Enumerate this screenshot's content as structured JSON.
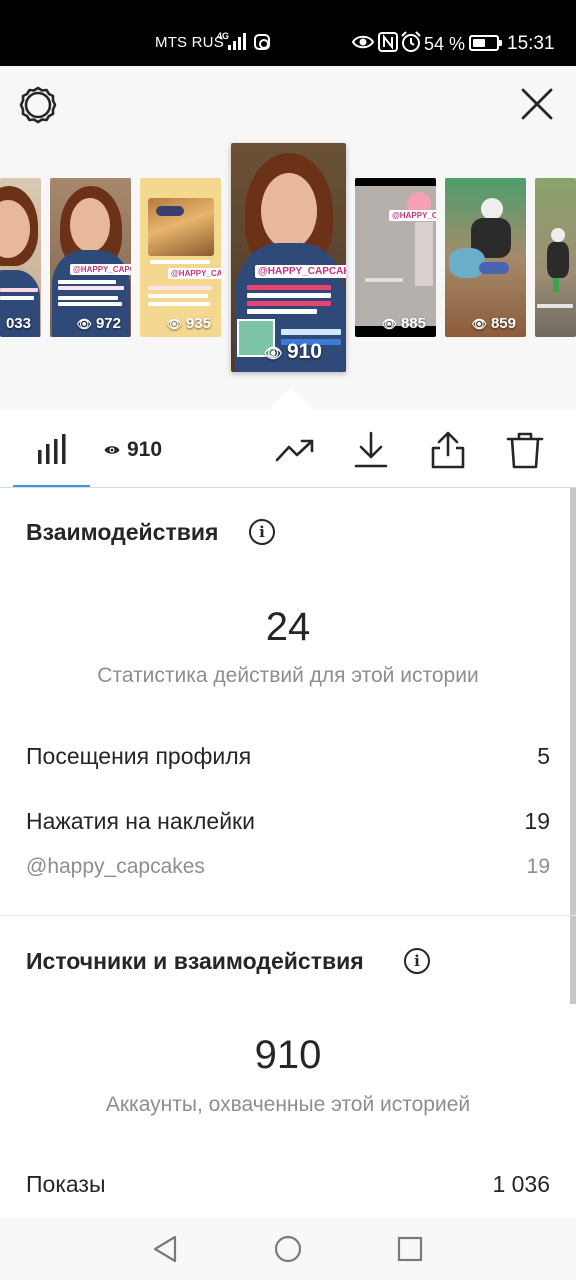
{
  "status_bar": {
    "carrier": "MTS RUS",
    "network": "4G",
    "battery_percent": "54 %",
    "battery_level": 0.54,
    "time": "15:31"
  },
  "header": {
    "settings_icon": "gear-icon",
    "close_icon": "close-icon"
  },
  "stories": [
    {
      "views": "033",
      "tag": "",
      "style": "woman-face"
    },
    {
      "views": "972",
      "tag": "@HAPPY_CAPCAKES",
      "style": "woman"
    },
    {
      "views": "935",
      "tag": "@HAPPY_CAPCAKES",
      "style": "cake"
    },
    {
      "views": "910",
      "tag": "@HAPPY_CAPCAKES",
      "style": "woman-selected"
    },
    {
      "views": "885",
      "tag": "@HAPPY_CAPCAKES",
      "style": "gray"
    },
    {
      "views": "859",
      "tag": "",
      "style": "kids"
    },
    {
      "views": "",
      "tag": "",
      "style": "outdoor"
    }
  ],
  "tabs": {
    "views_count": "910",
    "icons": [
      "bar-chart-icon",
      "eye-icon",
      "trending-icon",
      "download-icon",
      "share-icon",
      "trash-icon"
    ]
  },
  "interactions": {
    "title": "Взаимодействия",
    "total": "24",
    "caption": "Статистика действий для этой истории",
    "rows": [
      {
        "label": "Посещения профиля",
        "value": "5"
      },
      {
        "label": "Нажатия на наклейки",
        "value": "19"
      }
    ],
    "sub_row": {
      "label": "@happy_capcakes",
      "value": "19"
    }
  },
  "discovery": {
    "title": "Источники и взаимодействия",
    "total": "910",
    "caption": "Аккаунты, охваченные этой историей",
    "rows": [
      {
        "label": "Показы",
        "value": "1 036"
      }
    ]
  },
  "colors": {
    "accent": "#3897f0",
    "text": "#262626",
    "muted": "#8e8e8e"
  }
}
